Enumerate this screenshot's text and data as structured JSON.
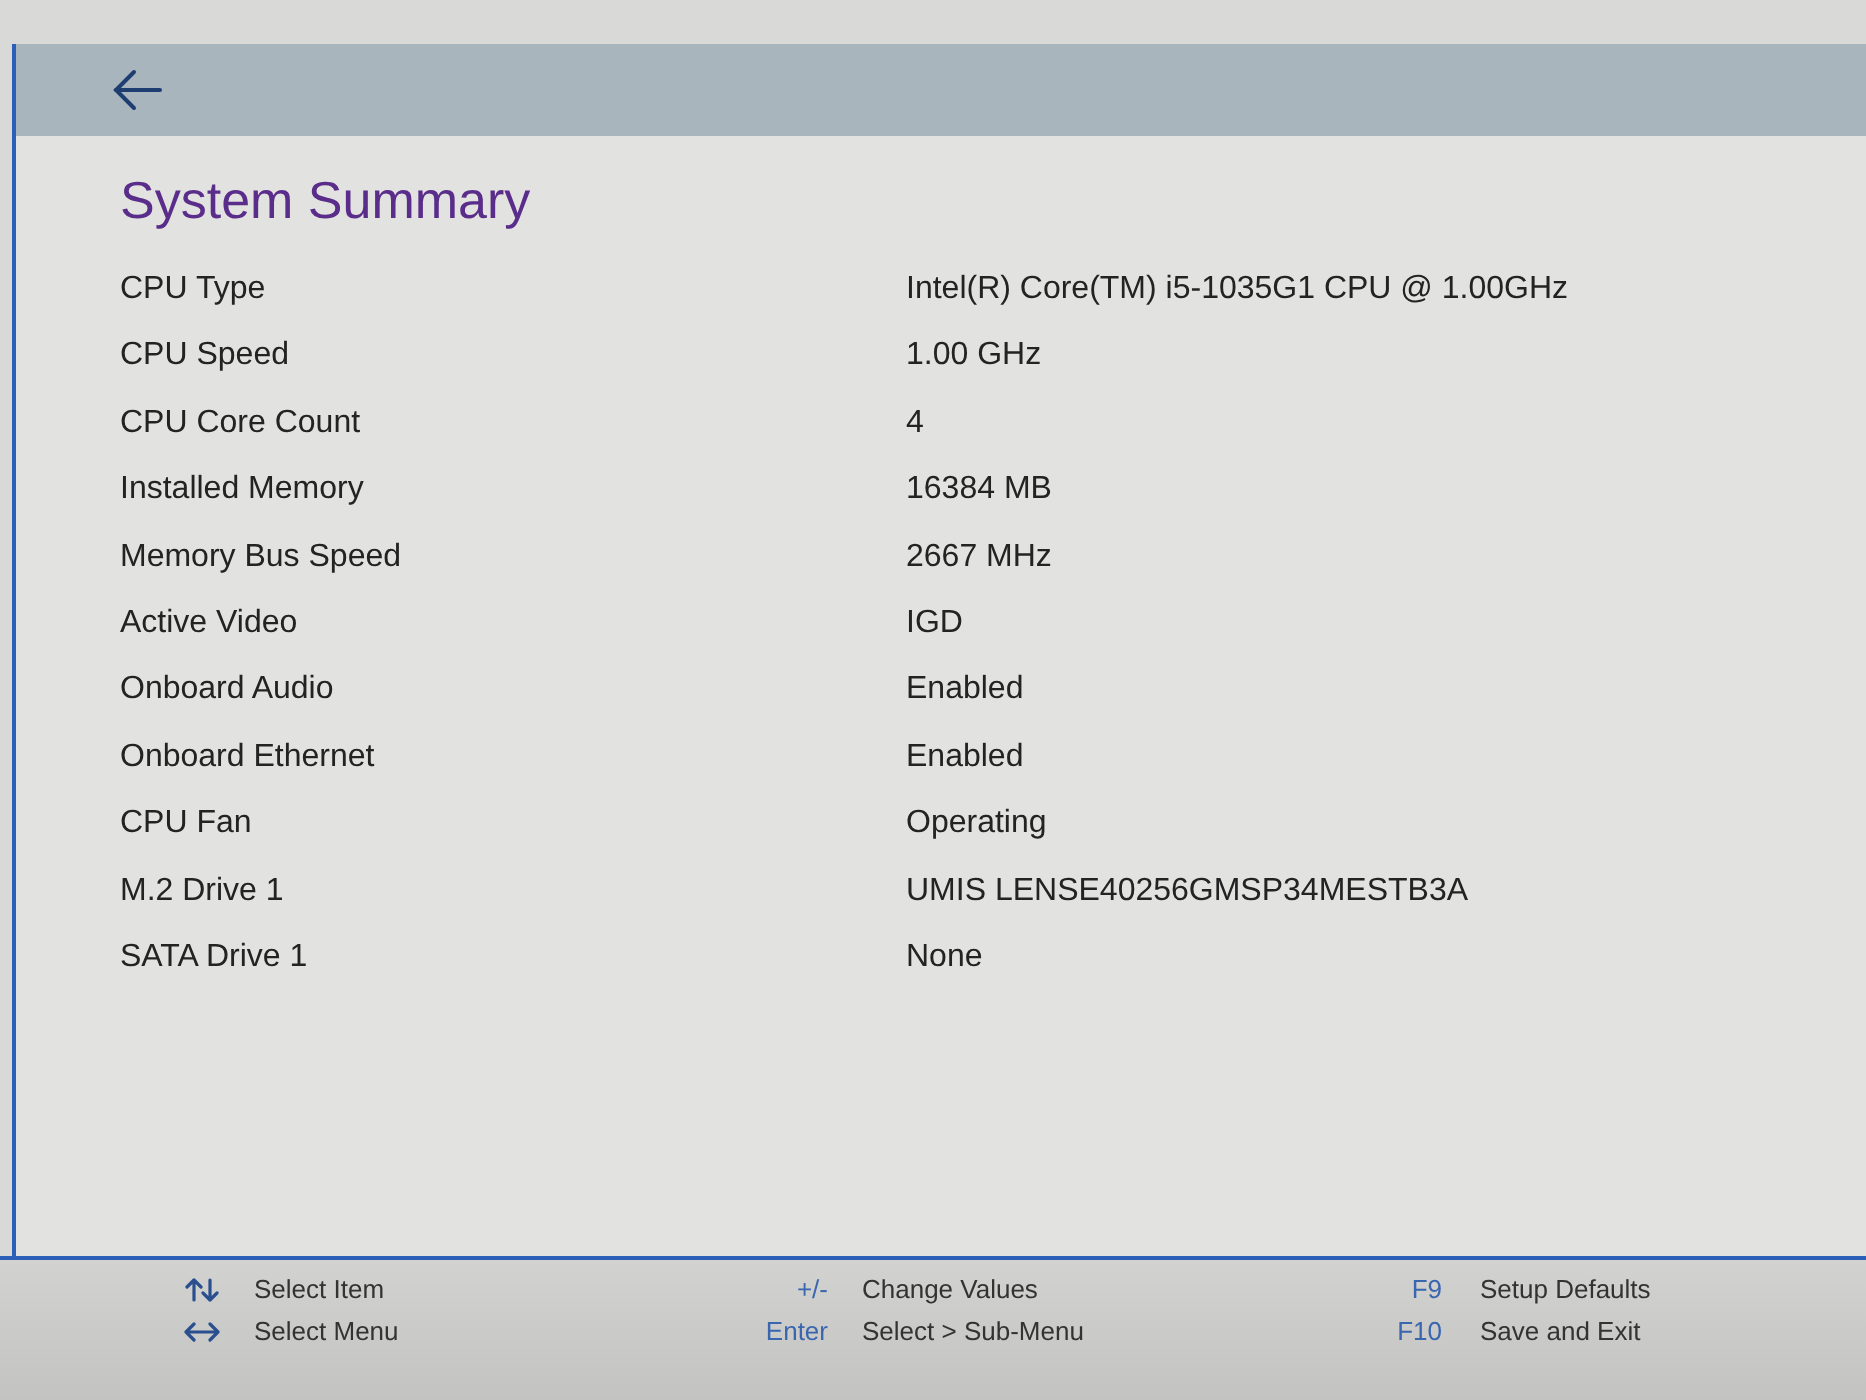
{
  "title": "System Summary",
  "rows": [
    {
      "label": "CPU Type",
      "value": "Intel(R) Core(TM) i5-1035G1 CPU @ 1.00GHz"
    },
    {
      "label": "CPU Speed",
      "value": "1.00 GHz"
    },
    {
      "label": "CPU Core Count",
      "value": "4"
    },
    {
      "label": "Installed Memory",
      "value": "16384 MB"
    },
    {
      "label": "Memory Bus Speed",
      "value": "2667 MHz"
    },
    {
      "label": "Active Video",
      "value": "IGD"
    },
    {
      "label": "Onboard Audio",
      "value": "Enabled"
    },
    {
      "label": "Onboard Ethernet",
      "value": "Enabled"
    },
    {
      "label": "CPU Fan",
      "value": "Operating"
    },
    {
      "label": "M.2 Drive 1",
      "value": "UMIS LENSE40256GMSP34MESTB3A"
    },
    {
      "label": "SATA Drive 1",
      "value": "None"
    }
  ],
  "footer": {
    "columns": [
      [
        {
          "kind": "updown",
          "action": "Select Item"
        },
        {
          "kind": "leftright",
          "action": "Select Menu"
        }
      ],
      [
        {
          "kind": "key",
          "key": "+/-",
          "action": "Change Values"
        },
        {
          "kind": "key",
          "key": "Enter",
          "action": "Select > Sub-Menu"
        }
      ],
      [
        {
          "kind": "key",
          "key": "F9",
          "action": "Setup Defaults"
        },
        {
          "kind": "key",
          "key": "F10",
          "action": "Save and Exit"
        }
      ]
    ]
  }
}
